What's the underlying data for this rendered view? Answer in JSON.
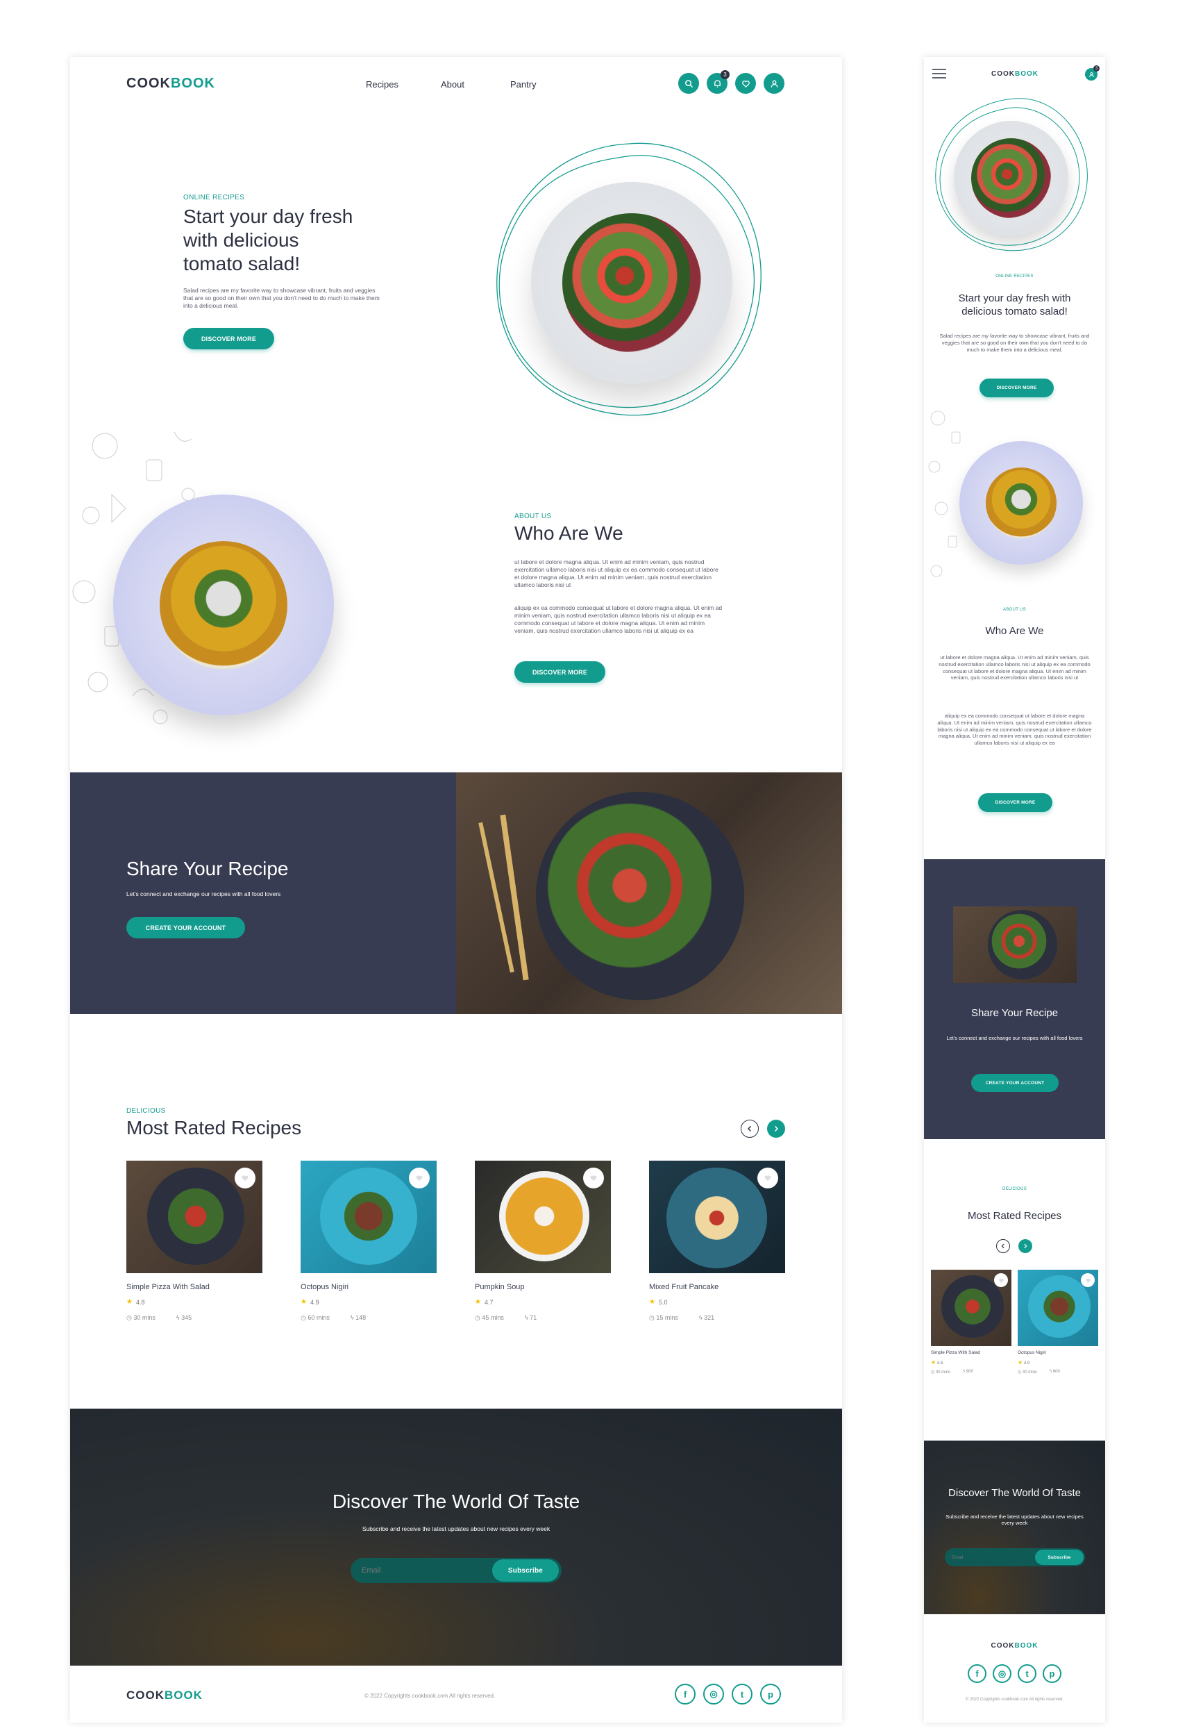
{
  "desktop": {
    "logo": {
      "part1": "COOK",
      "part2": "BOOK"
    },
    "nav": [
      "Recipes",
      "About",
      "Pantry"
    ],
    "notif_count": "3",
    "hero": {
      "kicker": "ONLINE RECIPES",
      "title_lines": [
        "Start your day fresh",
        "with delicious",
        "tomato salad!"
      ],
      "body": "Salad recipes are my favorite way to showcase vibrant, fruits and veggies that are so good on their own  that you don't need to do much to make them into a delicious meal.",
      "button": "DISCOVER MORE"
    },
    "about": {
      "kicker": "ABOUT US",
      "title": "Who Are We",
      "para1": "ut labore et dolore magna aliqua. Ut enim ad minim veniam, quis nostrud exercitation ullamco laboris nisi ut aliquip ex ea commodo consequat ut labore et dolore magna aliqua. Ut enim ad minim veniam, quis nostrud exercitation ullamco laboris nisi ut",
      "para2": "aliquip ex ea commodo consequat ut labore et dolore magna aliqua. Ut enim ad minim veniam, quis nostrud exercitation ullamco laboris nisi ut aliquip ex ea commodo consequat ut labore et dolore magna aliqua. Ut enim ad minim veniam, quis nostrud exercitation ullamco laboris nisi ut aliquip ex ea",
      "button": "DISCOVER MORE"
    },
    "share": {
      "title": "Share Your Recipe",
      "subtitle": "Let's connect and exchange our recipes with all food lovers",
      "button": "CREATE YOUR ACCOUNT"
    },
    "rated": {
      "kicker": "DELICIOUS",
      "title": "Most Rated Recipes",
      "cards": [
        {
          "name": "Simple Pizza With Salad",
          "rating": "4.8",
          "time": "30 mins",
          "cal": "345"
        },
        {
          "name": "Octopus Nigiri",
          "rating": "4.9",
          "time": "60 mins",
          "cal": "148"
        },
        {
          "name": "Pumpkin Soup",
          "rating": "4.7",
          "time": "45 mins",
          "cal": "71"
        },
        {
          "name": "Mixed Fruit Pancake",
          "rating": "5.0",
          "time": "15 mins",
          "cal": "321"
        }
      ]
    },
    "discover": {
      "title": "Discover The World Of Taste",
      "subtitle": "Subscribe and receive the latest updates about new recipes every week",
      "email_placeholder": "Email",
      "button": "Subscribe"
    },
    "footer": {
      "copyright": "© 2022 Copyrights cookbook.com All rights reserved.",
      "socials": [
        "facebook-icon",
        "instagram-icon",
        "twitter-icon",
        "pinterest-icon"
      ]
    }
  },
  "mobile": {
    "logo": {
      "part1": "COOK",
      "part2": "BOOK"
    },
    "notif_count": "3",
    "hero": {
      "kicker": "ONLINE RECIPES",
      "title": "Start your day fresh with delicious tomato salad!",
      "body": "Salad recipes are my favorite way to showcase vibrant, fruits and veggies that are so good on their own  that you don't need to do much to make them into a delicious meal.",
      "button": "DISCOVER MORE"
    },
    "about": {
      "kicker": "ABOUT US",
      "title": "Who Are We",
      "para1": "ut labore et dolore magna aliqua. Ut enim ad minim veniam, quis nostrud exercitation ullamco laboris nisi ut aliquip ex ea commodo consequat ut labore et dolore magna aliqua. Ut enim ad minim veniam, quis nostrud exercitation ullamco laboris nisi ut",
      "para2": "aliquip ex ea commodo consequat ut labore et dolore magna aliqua. Ut enim ad minim veniam, quis nostrud exercitation ullamco laboris nisi ut aliquip ex ea commodo consequat ut labore et dolore magna aliqua. Ut enim ad minim veniam, quis nostrud exercitation ullamco laboris nisi ut aliquip ex ea",
      "button": "DISCOVER MORE"
    },
    "share": {
      "title": "Share Your Recipe",
      "subtitle": "Let's connect and exchange our recipes with all food lovers",
      "button": "CREATE YOUR ACCOUNT"
    },
    "rated": {
      "kicker": "DELICIOUS",
      "title": "Most Rated Recipes",
      "cards": [
        {
          "name": "Simple Pizza With Salad",
          "rating": "4.8",
          "time": "30 mins",
          "cal": "900"
        },
        {
          "name": "Octopus Nigiri",
          "rating": "4.9",
          "time": "30 mins",
          "cal": "800"
        }
      ]
    },
    "discover": {
      "title": "Discover The World Of Taste",
      "subtitle": "Subscribe and receive the latest updates about new recipes every week",
      "email_placeholder": "Email",
      "button": "Subscribe"
    },
    "footer": {
      "copyright": "© 2022 Copyrights cookbook.com All rights reserved."
    }
  },
  "colors": {
    "accent": "#129c8e",
    "dark": "#383c52",
    "text": "#2d3142"
  }
}
